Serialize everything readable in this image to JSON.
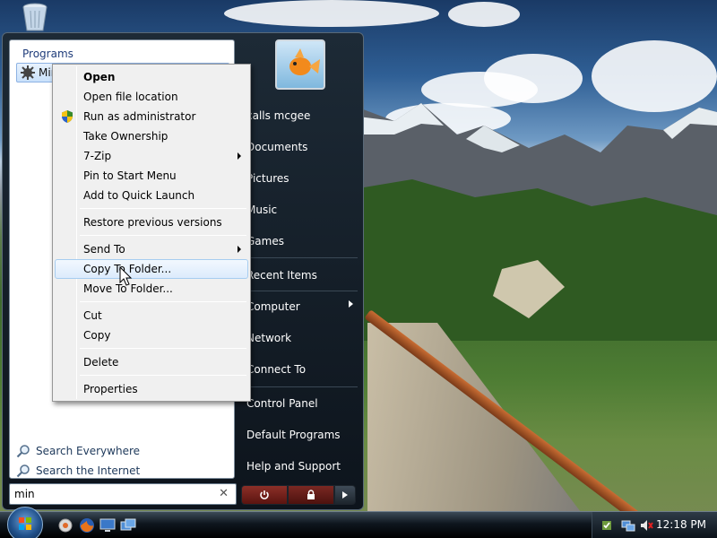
{
  "start_menu": {
    "programs_label": "Programs",
    "program_item": "Minesweeper",
    "search_links": [
      "Search Everywhere",
      "Search the Internet"
    ],
    "search_value": "min",
    "search_clear": "✕",
    "right_items": {
      "user": "calls mcgee",
      "documents": "Documents",
      "pictures": "Pictures",
      "music": "Music",
      "games": "Games",
      "recent_items": "Recent Items",
      "computer": "Computer",
      "network": "Network",
      "connect_to": "Connect To",
      "control_panel": "Control Panel",
      "default_programs": "Default Programs",
      "help_support": "Help and Support"
    }
  },
  "context_menu": {
    "items": [
      {
        "label": "Open",
        "bold": true
      },
      {
        "label": "Open file location"
      },
      {
        "label": "Run as administrator",
        "icon": "uac-shield-icon"
      },
      {
        "label": "Take Ownership"
      },
      {
        "label": "7-Zip",
        "submenu": true
      },
      {
        "label": "Pin to Start Menu"
      },
      {
        "label": "Add to Quick Launch"
      },
      {
        "label": "Restore previous versions"
      },
      {
        "label": "Send To",
        "submenu": true
      },
      {
        "label": "Copy To Folder...",
        "highlighted": true
      },
      {
        "label": "Move To Folder..."
      },
      {
        "label": "Cut"
      },
      {
        "label": "Copy"
      },
      {
        "label": "Delete"
      },
      {
        "label": "Properties"
      }
    ]
  },
  "taskbar": {
    "clock": "12:18 PM",
    "quick_launch": [
      "show-desktop-icon",
      "firefox-icon",
      "monitor-icon",
      "switch-windows-icon"
    ],
    "tray_icons": [
      "safely-remove-icon",
      "network-icon",
      "volume-muted-icon"
    ]
  },
  "colors": {
    "menu_dark": "#0d141c",
    "highlight": "#dcebfc",
    "accent_blue": "#1f3c7a"
  }
}
